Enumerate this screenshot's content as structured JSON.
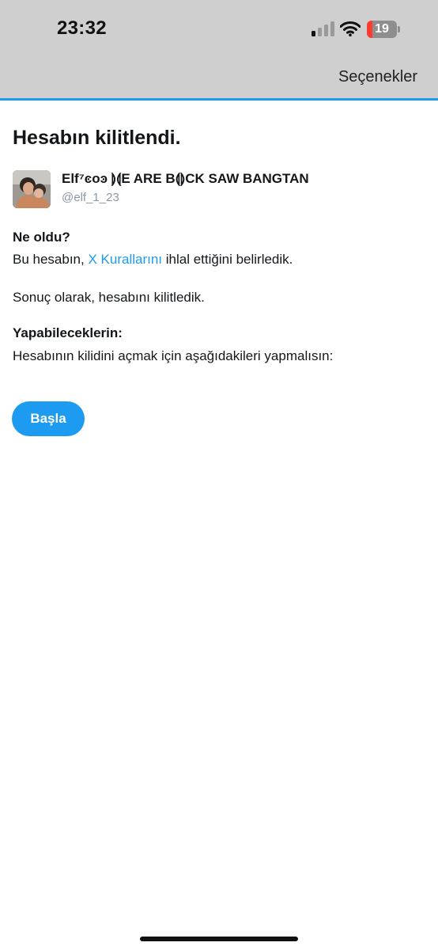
{
  "status_bar": {
    "time": "23:32",
    "signal_bars_active": 1,
    "signal_bars_total": 4,
    "battery_level": "19",
    "icons": [
      "cellular-signal-icon",
      "wifi-icon",
      "battery-icon"
    ],
    "colors": {
      "battery_low": "#ff3b30",
      "battery_body": "#8e8e8e"
    }
  },
  "header": {
    "options_label": "Seçenekler",
    "accent_color": "#1d9bf0"
  },
  "main": {
    "title": "Hesabın kilitlendi.",
    "account": {
      "display_name": "Elf⁷ͼoͽ ⟭⟬E ARE B⟬⟭CK SAW BANGTAN",
      "handle": "@elf_1_23"
    },
    "what_happened": {
      "heading": "Ne oldu?",
      "text_before": "Bu hesabın, ",
      "link_text": "X Kurallarını",
      "text_after": " ihlal ettiğini belirledik.",
      "result": "Sonuç olarak, hesabını kilitledik."
    },
    "what_you_can_do": {
      "heading": "Yapabileceklerin:",
      "text": "Hesabının kilidini açmak için aşağıdakileri yapmalısın:"
    },
    "start_button_label": "Başla"
  }
}
